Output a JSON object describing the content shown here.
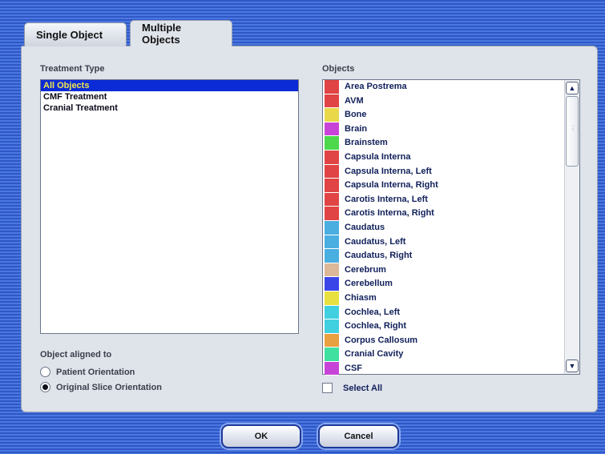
{
  "tabs": [
    {
      "label": "Single Object",
      "active": false
    },
    {
      "label": "Multiple Objects",
      "active": true
    }
  ],
  "treatment_type": {
    "label": "Treatment Type",
    "items": [
      {
        "label": "All Objects",
        "selected": true
      },
      {
        "label": "CMF Treatment",
        "selected": false
      },
      {
        "label": "Cranial Treatment",
        "selected": false
      }
    ]
  },
  "objects": {
    "label": "Objects",
    "items": [
      {
        "name": "Area Postrema",
        "color": "#e04444"
      },
      {
        "name": "AVM",
        "color": "#e04444"
      },
      {
        "name": "Bone",
        "color": "#e8d84a"
      },
      {
        "name": "Brain",
        "color": "#c843d8"
      },
      {
        "name": "Brainstem",
        "color": "#4cd84a"
      },
      {
        "name": "Capsula Interna",
        "color": "#e04444"
      },
      {
        "name": "Capsula Interna, Left",
        "color": "#e04444"
      },
      {
        "name": "Capsula Interna, Right",
        "color": "#e04444"
      },
      {
        "name": "Carotis Interna, Left",
        "color": "#e04444"
      },
      {
        "name": "Carotis Interna, Right",
        "color": "#e04444"
      },
      {
        "name": "Caudatus",
        "color": "#4aaee0"
      },
      {
        "name": "Caudatus, Left",
        "color": "#4aaee0"
      },
      {
        "name": "Caudatus, Right",
        "color": "#4aaee0"
      },
      {
        "name": "Cerebrum",
        "color": "#dcb898"
      },
      {
        "name": "Cerebellum",
        "color": "#3a46e8"
      },
      {
        "name": "Chiasm",
        "color": "#e8e040"
      },
      {
        "name": "Cochlea, Left",
        "color": "#40d0e0"
      },
      {
        "name": "Cochlea, Right",
        "color": "#40d0e0"
      },
      {
        "name": "Corpus Callosum",
        "color": "#e8a040"
      },
      {
        "name": "Cranial Cavity",
        "color": "#40e0a0"
      },
      {
        "name": "CSF",
        "color": "#c843d8"
      }
    ],
    "scroll_up_icon": "up-arrow",
    "scroll_down_icon": "down-arrow"
  },
  "select_all": {
    "label": "Select All",
    "checked": false
  },
  "alignment": {
    "label": "Object aligned to",
    "options": [
      {
        "label": "Patient Orientation",
        "selected": false
      },
      {
        "label": "Original Slice Orientation",
        "selected": true
      }
    ]
  },
  "buttons": {
    "ok": "OK",
    "cancel": "Cancel"
  }
}
